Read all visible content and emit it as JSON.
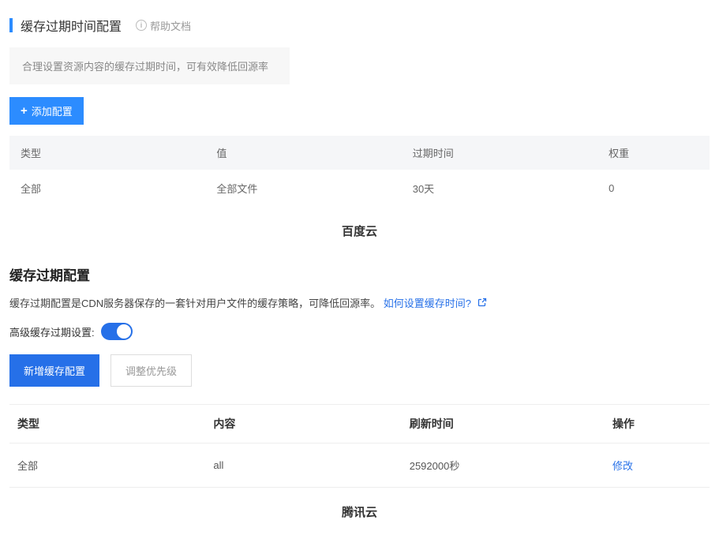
{
  "section1": {
    "title": "缓存过期时间配置",
    "help_label": "帮助文档",
    "info_text": "合理设置资源内容的缓存过期时间，可有效降低回源率",
    "add_button": "添加配置",
    "table": {
      "headers": [
        "类型",
        "值",
        "过期时间",
        "权重"
      ],
      "rows": [
        {
          "type": "全部",
          "value": "全部文件",
          "expire": "30天",
          "weight": "0"
        }
      ]
    },
    "caption": "百度云"
  },
  "section2": {
    "title": "缓存过期配置",
    "desc_prefix": "缓存过期配置是CDN服务器保存的一套针对用户文件的缓存策略，可降低回源率。",
    "desc_link": "如何设置缓存时间?",
    "toggle_label": "高级缓存过期设置:",
    "btn_primary": "新增缓存配置",
    "btn_secondary": "调整优先级",
    "table": {
      "headers": [
        "类型",
        "内容",
        "刷新时间",
        "操作"
      ],
      "rows": [
        {
          "type": "全部",
          "content": "all",
          "refresh": "2592000秒",
          "action": "修改"
        }
      ]
    },
    "caption": "腾讯云"
  }
}
